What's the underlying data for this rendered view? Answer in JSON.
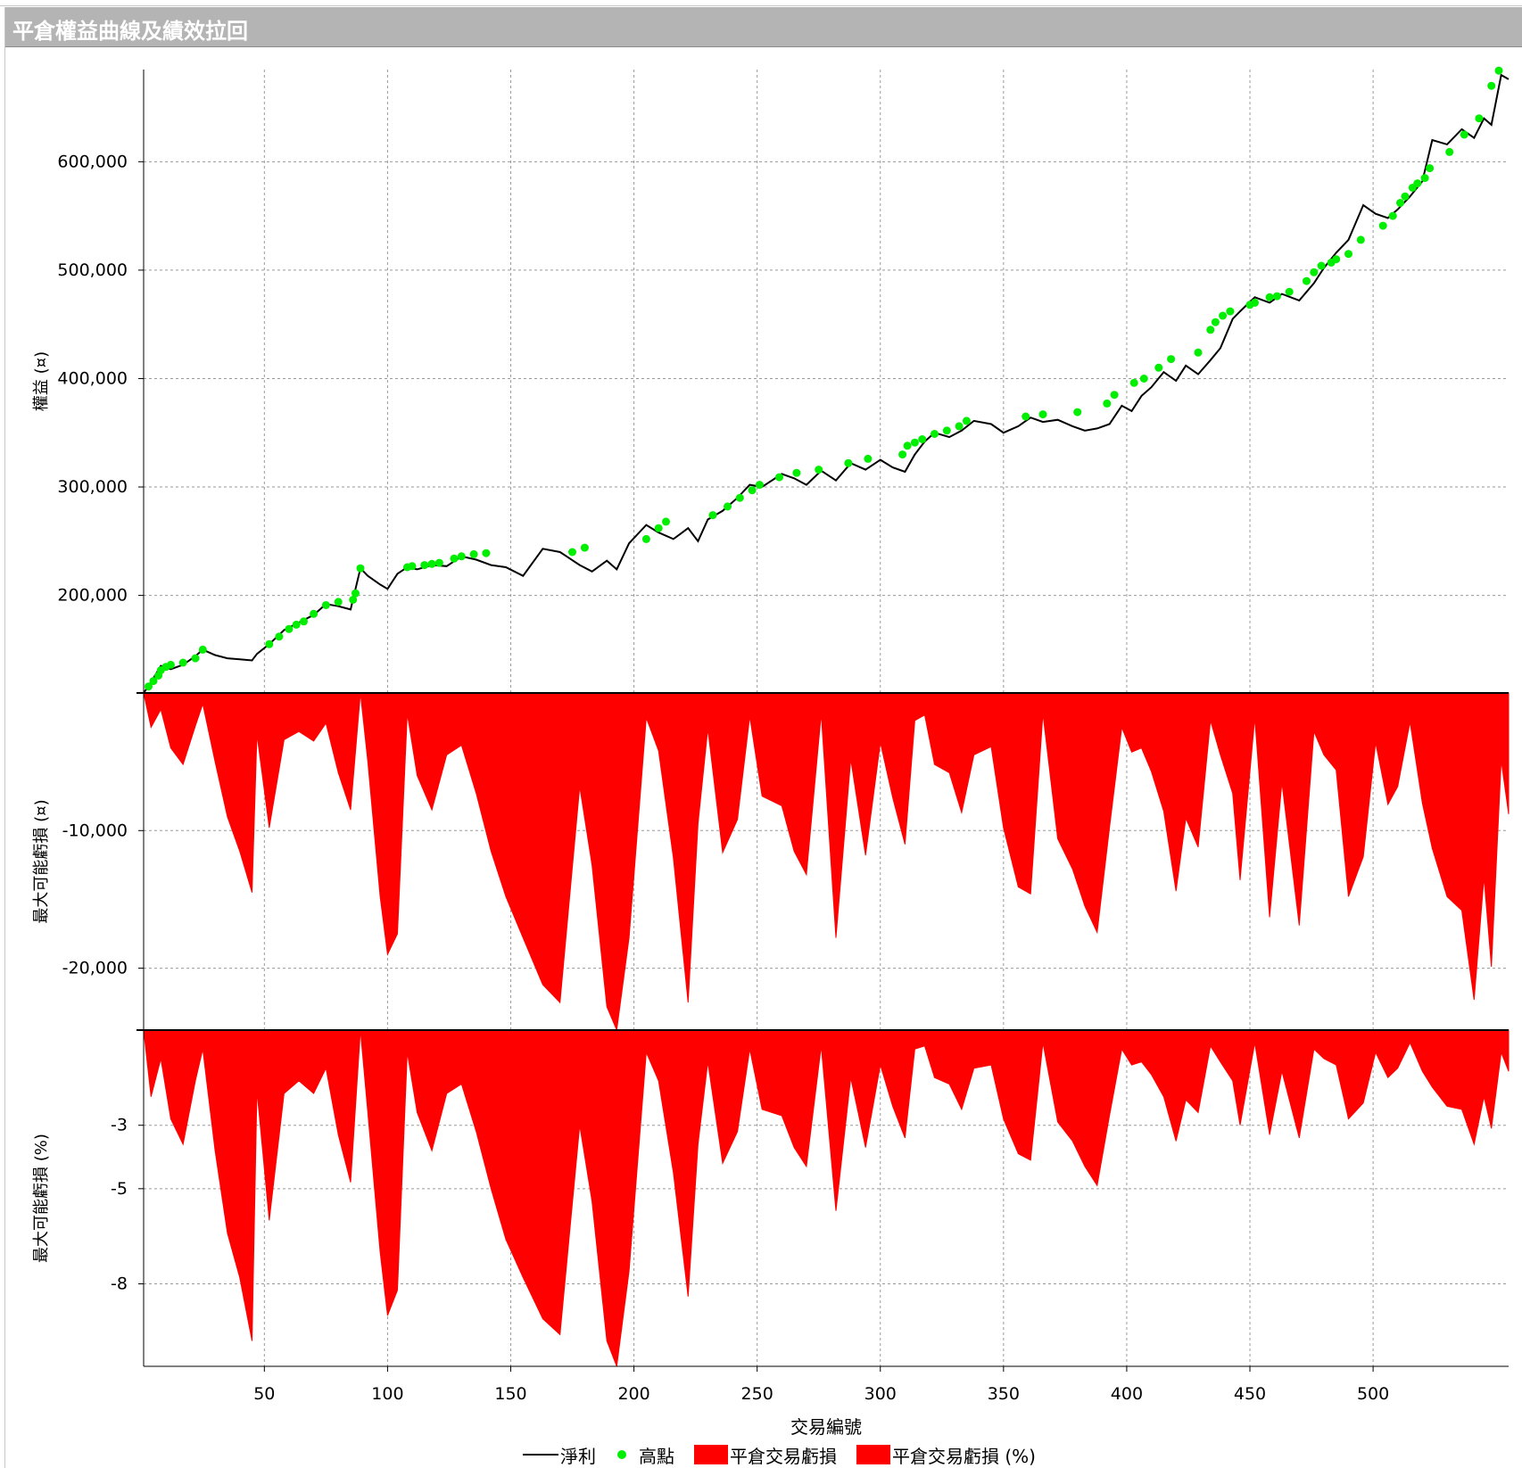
{
  "panel": {
    "title": "平倉權益曲線及績效拉回"
  },
  "x_axis": {
    "title": "交易編號",
    "ticks": [
      "50",
      "100",
      "150",
      "200",
      "250",
      "300",
      "350",
      "400",
      "450",
      "500"
    ]
  },
  "legend": {
    "net_profit": "淨利",
    "new_high": "高點",
    "drawdown": "平倉交易虧損",
    "drawdown_pct": "平倉交易虧損 (%)"
  },
  "colors": {
    "equity_line": "#000000",
    "high_point": "#00ee00",
    "drawdown_fill": "#ff0000",
    "header_bg": "#b4b4b4"
  },
  "chart_data": [
    {
      "type": "line",
      "ylabel": "權益 (¤)",
      "ylim": [
        110000,
        685000
      ],
      "yticks": [
        "200,000",
        "300,000",
        "400,000",
        "500,000",
        "600,000"
      ],
      "xlim": [
        1,
        555
      ],
      "grid": true,
      "series": [
        {
          "name": "淨利",
          "x": [
            1,
            4,
            8,
            12,
            17,
            22,
            25,
            30,
            35,
            40,
            45,
            47,
            52,
            58,
            64,
            70,
            75,
            80,
            85,
            89,
            92,
            97,
            100,
            104,
            108,
            112,
            118,
            124,
            130,
            136,
            142,
            148,
            155,
            163,
            170,
            178,
            183,
            189,
            193,
            198,
            205,
            210,
            216,
            222,
            226,
            230,
            236,
            242,
            247,
            252,
            260,
            265,
            270,
            276,
            282,
            288,
            294,
            300,
            305,
            310,
            314,
            318,
            322,
            328,
            333,
            338,
            345,
            350,
            356,
            361,
            366,
            372,
            378,
            383,
            388,
            393,
            398,
            402,
            406,
            410,
            415,
            420,
            424,
            429,
            434,
            438,
            443,
            446,
            452,
            458,
            463,
            470,
            476,
            480,
            485,
            490,
            496,
            501,
            506,
            510,
            515,
            520,
            524,
            530,
            536,
            541,
            545,
            548,
            552,
            555
          ],
          "values": [
            110000,
            120000,
            135000,
            132000,
            136000,
            144000,
            150000,
            145000,
            142000,
            141000,
            140000,
            146000,
            155000,
            168000,
            175000,
            182000,
            192000,
            190000,
            187000,
            225000,
            218000,
            210000,
            206000,
            220000,
            226000,
            224000,
            228000,
            227000,
            236000,
            233000,
            228000,
            226000,
            218000,
            243000,
            240000,
            228000,
            222000,
            232000,
            224000,
            248000,
            265000,
            258000,
            252000,
            262000,
            250000,
            270000,
            278000,
            290000,
            302000,
            300000,
            312000,
            308000,
            302000,
            315000,
            306000,
            322000,
            316000,
            325000,
            318000,
            314000,
            330000,
            342000,
            350000,
            346000,
            352000,
            361000,
            358000,
            350000,
            356000,
            364000,
            360000,
            362000,
            356000,
            352000,
            354000,
            358000,
            375000,
            370000,
            384000,
            392000,
            406000,
            398000,
            412000,
            404000,
            417000,
            428000,
            455000,
            462000,
            475000,
            470000,
            478000,
            472000,
            488000,
            502000,
            516000,
            528000,
            560000,
            552000,
            548000,
            556000,
            568000,
            582000,
            620000,
            616000,
            630000,
            622000,
            640000,
            634000,
            680000,
            676000
          ]
        },
        {
          "name": "高點",
          "x": [
            3,
            5,
            7,
            8,
            10,
            12,
            17,
            22,
            25,
            52,
            56,
            60,
            63,
            66,
            70,
            75,
            80,
            86,
            87,
            89,
            108,
            110,
            115,
            118,
            121,
            127,
            130,
            135,
            140,
            175,
            180,
            205,
            210,
            213,
            232,
            238,
            243,
            248,
            251,
            259,
            266,
            275,
            287,
            295,
            309,
            311,
            314,
            317,
            322,
            327,
            332,
            335,
            359,
            366,
            380,
            392,
            395,
            403,
            407,
            413,
            418,
            429,
            434,
            436,
            439,
            442,
            450,
            452,
            458,
            461,
            466,
            473,
            476,
            479,
            483,
            485,
            490,
            495,
            504,
            508,
            511,
            513,
            516,
            518,
            521,
            523,
            531,
            537,
            543,
            548,
            551
          ],
          "values": [
            116000,
            121000,
            126000,
            131000,
            134000,
            136000,
            138000,
            142000,
            150000,
            155000,
            162000,
            169000,
            173000,
            176000,
            183000,
            191000,
            194000,
            196000,
            202000,
            225000,
            226000,
            227000,
            228000,
            229000,
            230000,
            234000,
            236000,
            238000,
            239000,
            240000,
            244000,
            252000,
            262000,
            268000,
            274000,
            282000,
            290000,
            297000,
            302000,
            309000,
            313000,
            316000,
            322000,
            326000,
            330000,
            338000,
            341000,
            344000,
            349000,
            352000,
            356000,
            361000,
            365000,
            367000,
            369000,
            377000,
            385000,
            396000,
            400000,
            410000,
            418000,
            424000,
            445000,
            452000,
            458000,
            462000,
            468000,
            470000,
            475000,
            476000,
            480000,
            490000,
            498000,
            504000,
            507000,
            510000,
            515000,
            528000,
            541000,
            550000,
            562000,
            568000,
            576000,
            580000,
            585000,
            594000,
            609000,
            625000,
            640000,
            670000,
            684000
          ]
        }
      ]
    },
    {
      "type": "area",
      "ylabel": "最大可能虧損 (¤)",
      "ylim": [
        -24500,
        0
      ],
      "yticks": [
        "-10,000",
        "-20,000"
      ],
      "series": [
        {
          "name": "平倉交易虧損",
          "x": [
            1,
            4,
            8,
            12,
            17,
            22,
            25,
            30,
            35,
            40,
            45,
            47,
            52,
            58,
            64,
            70,
            75,
            80,
            85,
            89,
            92,
            97,
            100,
            104,
            108,
            112,
            118,
            124,
            130,
            136,
            142,
            148,
            155,
            163,
            170,
            178,
            183,
            189,
            193,
            198,
            205,
            210,
            216,
            222,
            226,
            230,
            236,
            242,
            247,
            252,
            260,
            265,
            270,
            276,
            282,
            288,
            294,
            300,
            305,
            310,
            314,
            318,
            322,
            328,
            333,
            338,
            345,
            350,
            356,
            361,
            366,
            372,
            378,
            383,
            388,
            393,
            398,
            402,
            406,
            410,
            415,
            420,
            424,
            429,
            434,
            438,
            443,
            446,
            452,
            458,
            463,
            470,
            476,
            480,
            485,
            490,
            496,
            501,
            506,
            510,
            515,
            520,
            524,
            530,
            536,
            541,
            545,
            548,
            552,
            555
          ],
          "values": [
            0,
            -2500,
            -1200,
            -4000,
            -5200,
            -2400,
            -800,
            -5000,
            -9000,
            -11500,
            -14500,
            -3000,
            -9800,
            -3400,
            -2800,
            -3500,
            -2200,
            -5800,
            -8500,
            0,
            -5000,
            -14800,
            -19000,
            -17500,
            -1500,
            -6000,
            -8500,
            -4500,
            -3800,
            -7300,
            -11500,
            -14800,
            -17800,
            -21200,
            -22500,
            -6800,
            -12500,
            -22800,
            -24500,
            -17800,
            -1800,
            -4200,
            -12000,
            -22500,
            -9500,
            -2600,
            -11600,
            -9200,
            -1700,
            -7500,
            -8200,
            -11500,
            -13200,
            -1500,
            -17800,
            -4800,
            -11800,
            -3600,
            -7600,
            -11000,
            -2000,
            -1600,
            -5200,
            -5800,
            -8700,
            -4500,
            -3900,
            -9800,
            -14100,
            -14600,
            -1500,
            -10600,
            -12800,
            -15500,
            -17400,
            -9800,
            -2500,
            -4300,
            -4000,
            -5700,
            -8600,
            -14400,
            -9100,
            -11200,
            -2000,
            -4500,
            -7300,
            -13600,
            -1800,
            -16300,
            -6500,
            -16900,
            -2800,
            -4500,
            -5600,
            -14800,
            -11900,
            -3600,
            -8100,
            -6800,
            -2100,
            -8000,
            -11300,
            -14800,
            -15800,
            -22300,
            -13400,
            -19900,
            -4900,
            -8800
          ]
        }
      ]
    },
    {
      "type": "area",
      "ylabel": "最大可能虧損 (%)",
      "ylim": [
        -10.6,
        0
      ],
      "yticks": [
        "-3",
        "-5",
        "-8"
      ],
      "series": [
        {
          "name": "平倉交易虧損 (%)",
          "x": [
            1,
            4,
            8,
            12,
            17,
            22,
            25,
            30,
            35,
            40,
            45,
            47,
            52,
            58,
            64,
            70,
            75,
            80,
            85,
            89,
            92,
            97,
            100,
            104,
            108,
            112,
            118,
            124,
            130,
            136,
            142,
            148,
            155,
            163,
            170,
            178,
            183,
            189,
            193,
            198,
            205,
            210,
            216,
            222,
            226,
            230,
            236,
            242,
            247,
            252,
            260,
            265,
            270,
            276,
            282,
            288,
            294,
            300,
            305,
            310,
            314,
            318,
            322,
            328,
            333,
            338,
            345,
            350,
            356,
            361,
            366,
            372,
            378,
            383,
            388,
            393,
            398,
            402,
            406,
            410,
            415,
            420,
            424,
            429,
            434,
            438,
            443,
            446,
            452,
            458,
            463,
            470,
            476,
            480,
            485,
            490,
            496,
            501,
            506,
            510,
            515,
            520,
            524,
            530,
            536,
            541,
            545,
            548,
            552,
            555
          ],
          "values": [
            0,
            -2.1,
            -0.9,
            -2.8,
            -3.6,
            -1.6,
            -0.6,
            -3.8,
            -6.4,
            -7.8,
            -9.8,
            -1.9,
            -6.0,
            -2.0,
            -1.6,
            -2.0,
            -1.2,
            -3.3,
            -4.8,
            0,
            -2.6,
            -7.0,
            -9.0,
            -8.2,
            -0.7,
            -2.6,
            -3.8,
            -2.0,
            -1.7,
            -3.2,
            -5.0,
            -6.6,
            -7.8,
            -9.1,
            -9.6,
            -3.0,
            -5.4,
            -9.8,
            -10.6,
            -7.6,
            -0.7,
            -1.6,
            -4.5,
            -8.4,
            -3.6,
            -1.0,
            -4.2,
            -3.2,
            -0.6,
            -2.5,
            -2.7,
            -3.7,
            -4.3,
            -0.5,
            -5.7,
            -1.5,
            -3.7,
            -1.1,
            -2.4,
            -3.4,
            -0.6,
            -0.5,
            -1.5,
            -1.7,
            -2.5,
            -1.2,
            -1.1,
            -2.8,
            -3.9,
            -4.1,
            -0.4,
            -2.9,
            -3.5,
            -4.3,
            -4.9,
            -2.7,
            -0.6,
            -1.1,
            -1.0,
            -1.4,
            -2.1,
            -3.5,
            -2.2,
            -2.6,
            -0.5,
            -1.0,
            -1.6,
            -3.0,
            -0.4,
            -3.3,
            -1.3,
            -3.4,
            -0.6,
            -0.9,
            -1.1,
            -2.8,
            -2.3,
            -0.7,
            -1.5,
            -1.2,
            -0.4,
            -1.3,
            -1.8,
            -2.4,
            -2.5,
            -3.6,
            -2.1,
            -3.1,
            -0.7,
            -1.3
          ]
        }
      ]
    }
  ]
}
